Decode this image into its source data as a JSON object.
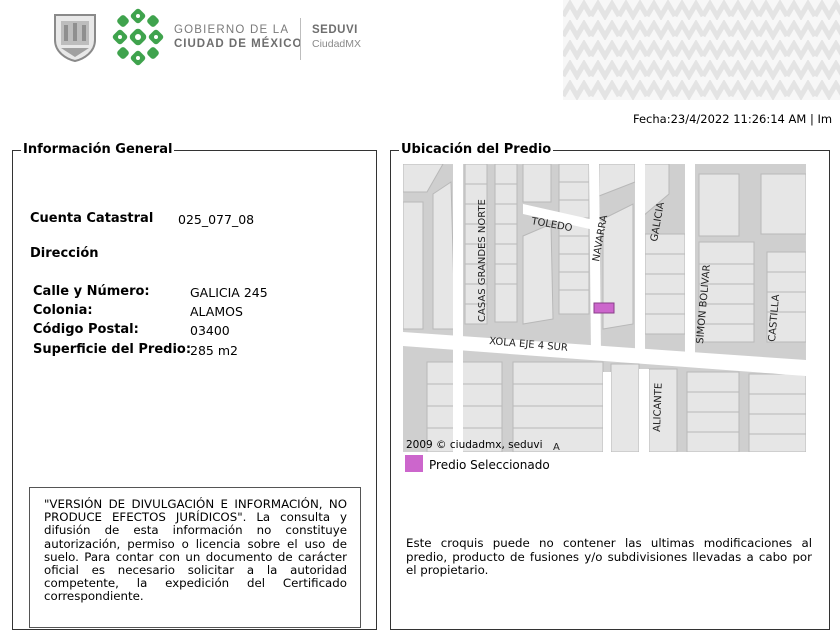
{
  "header": {
    "gov_line1": "GOBIERNO DE LA",
    "gov_line2": "CIUDAD DE MÉXICO",
    "agency": "SEDUVI",
    "agency_sub": "CiudadMX"
  },
  "fecha": "Fecha:23/4/2022 11:26:14 AM | Im",
  "general": {
    "legend": "Información General",
    "cuenta_label": "Cuenta Catastral",
    "cuenta_value": "025_077_08",
    "direccion_label": "Dirección",
    "fields": [
      {
        "label": "Calle y Número:",
        "value": "GALICIA 245"
      },
      {
        "label": "Colonia:",
        "value": "ALAMOS"
      },
      {
        "label": "Código Postal:",
        "value": "03400"
      },
      {
        "label": "Superficie del Predio:",
        "value": "285 m2"
      }
    ],
    "disclaimer": "\"VERSIÓN DE DIVULGACIÓN E INFORMACIÓN, NO PRODUCE EFECTOS JURÍDICOS\". La consulta y difusión de esta información no constituye autorización, permiso o licencia sobre el uso de suelo. Para contar con un documento de carácter oficial es necesario solicitar a la autoridad competente, la expedición del Certificado correspondiente."
  },
  "ubicacion": {
    "legend": "Ubicación del Predio",
    "map_credit": "2009 © ciudadmx, seduvi",
    "streets": {
      "casas": "CASAS GRANDES NORTE",
      "toledo": "TOLEDO",
      "navarra": "NAVARRA",
      "galicia": "GALICIA",
      "simon": "SIMON BOLIVAR",
      "castilla": "CASTILLA",
      "xola": "XOLA EJE 4 SUR",
      "alicante": "ALICANTE",
      "a": "A"
    },
    "legend_label": "Predio Seleccionado",
    "note": "Este croquis puede no contener las ultimas modificaciones al predio, producto de fusiones y/o subdivisiones llevadas a cabo por el propietario."
  },
  "colors": {
    "selected_lot": "#cc66cc",
    "block": "#e6e6e6",
    "street": "#ffffff",
    "map_bg": "#cfcfcf",
    "logo_green": "#3fa34d"
  }
}
